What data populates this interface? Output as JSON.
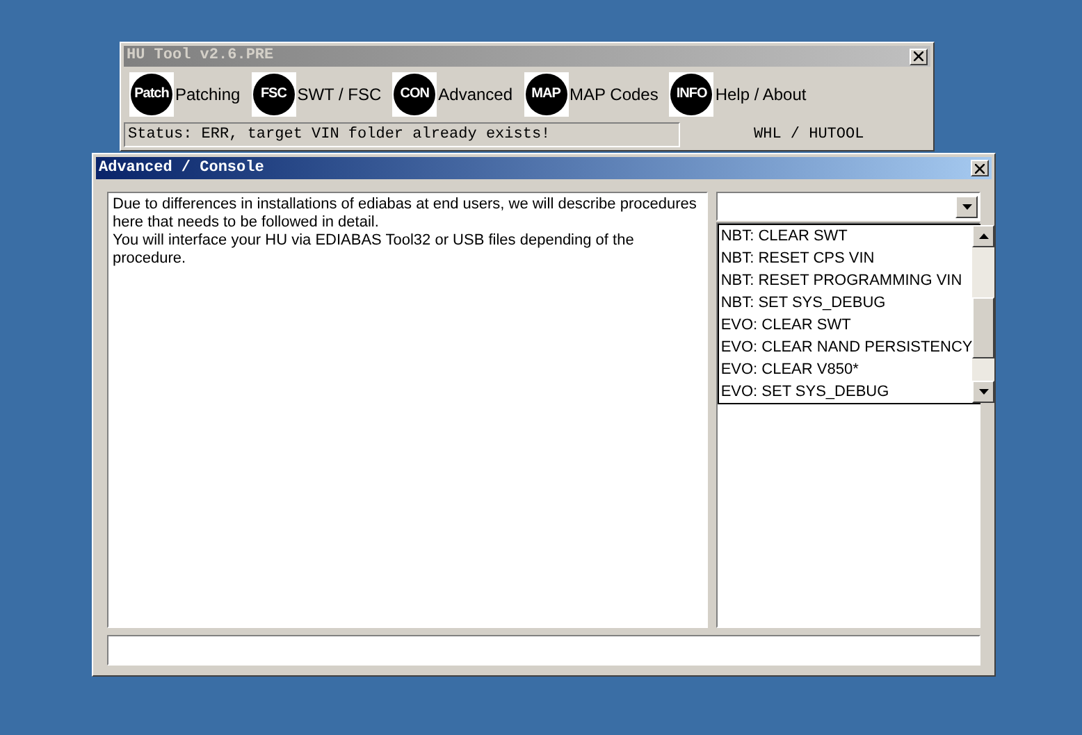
{
  "main_window": {
    "title": "HU Tool v2.6.PRE",
    "toolbar": [
      {
        "badge": "Patch",
        "label": "Patching"
      },
      {
        "badge": "FSC",
        "label": "SWT / FSC"
      },
      {
        "badge": "CON",
        "label": "Advanced"
      },
      {
        "badge": "MAP",
        "label": "MAP Codes"
      },
      {
        "badge": "INFO",
        "label": "Help / About"
      }
    ],
    "status": "Status: ERR, target VIN folder already exists!",
    "credit": "WHL / HUTOOL"
  },
  "console_window": {
    "title": "Advanced / Console",
    "description": [
      "Due to differences in installations of ediabas at end users, we will describe procedures here that needs to be followed in detail.",
      "You will interface your HU via EDIABAS Tool32 or USB files depending of the procedure."
    ],
    "dropdown_options": [
      "NBT: CLEAR SWT",
      "NBT: RESET CPS VIN",
      "NBT: RESET PROGRAMMING VIN",
      "NBT: SET SYS_DEBUG",
      "EVO: CLEAR SWT",
      "EVO: CLEAR NAND PERSISTENCY",
      "EVO: CLEAR V850*",
      "EVO: SET SYS_DEBUG"
    ]
  }
}
